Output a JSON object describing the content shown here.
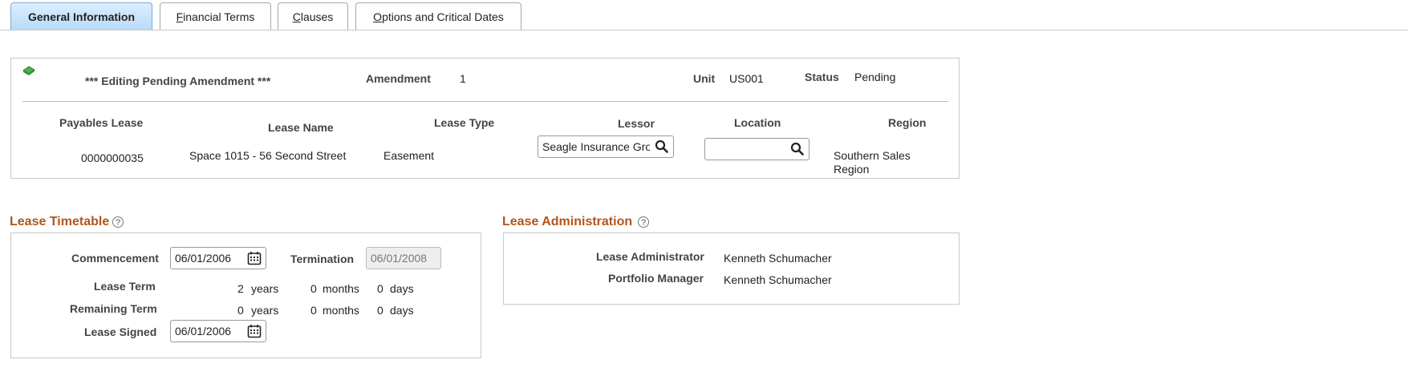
{
  "tabs": [
    {
      "label": "General Information",
      "key": ""
    },
    {
      "label": "inancial Terms",
      "key": "F"
    },
    {
      "label": "lauses",
      "key": "C"
    },
    {
      "label": "ptions and Critical Dates",
      "key": "O"
    }
  ],
  "header": {
    "banner": "*** Editing Pending Amendment ***",
    "amendment_label": "Amendment",
    "amendment_value": "1",
    "unit_label": "Unit",
    "unit_value": "US001",
    "status_label": "Status",
    "status_value": "Pending"
  },
  "lease_row": {
    "payables_lease_label": "Payables Lease",
    "payables_lease_value": "0000000035",
    "lease_name_label": "Lease Name",
    "lease_name_value": "Space 1015 - 56 Second Street",
    "lease_type_label": "Lease Type",
    "lease_type_value": "Easement",
    "lessor_label": "Lessor",
    "lessor_value": "Seagle Insurance Gro",
    "location_label": "Location",
    "location_value": "",
    "region_label": "Region",
    "region_line1": "Southern Sales",
    "region_line2": "Region"
  },
  "timetable": {
    "title": "Lease Timetable",
    "commencement_label": "Commencement",
    "commencement_value": "06/01/2006",
    "termination_label": "Termination",
    "termination_value": "06/01/2008",
    "lease_term_label": "Lease Term",
    "lease_term_years": "2",
    "lease_term_months": "0",
    "lease_term_days": "0",
    "remaining_term_label": "Remaining Term",
    "remaining_years": "0",
    "remaining_months": "0",
    "remaining_days": "0",
    "years_unit": "years",
    "months_unit": "months",
    "days_unit": "days",
    "lease_signed_label": "Lease Signed",
    "lease_signed_value": "06/01/2006"
  },
  "administration": {
    "title": "Lease Administration",
    "admin_label": "Lease Administrator",
    "admin_value": "Kenneth Schumacher",
    "portfolio_label": "Portfolio Manager",
    "portfolio_value": "Kenneth Schumacher"
  },
  "icons": {
    "help_glyph": "?"
  },
  "colors": {
    "section_title": "#b0561a",
    "active_tab": "#b9dbf8"
  }
}
